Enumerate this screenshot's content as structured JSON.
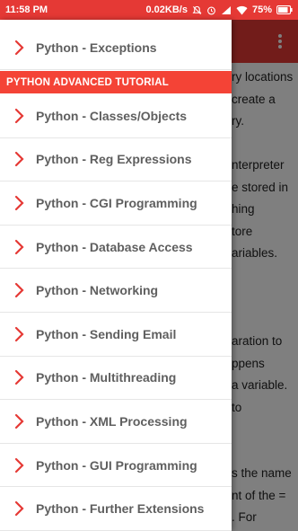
{
  "status_bar": {
    "time": "11:58 PM",
    "network_speed": "0.02KB/s",
    "battery": "75%",
    "icons": [
      "mute-icon",
      "alarm-icon",
      "signal-icon",
      "wifi-icon",
      "battery-icon"
    ]
  },
  "colors": {
    "accent": "#e53935",
    "section_header": "#f44336",
    "chevron": "#e53935",
    "item_text": "#5f5f5f"
  },
  "drawer": {
    "top_item": {
      "label": "Python - Exceptions"
    },
    "section_title": "PYTHON ADVANCED TUTORIAL",
    "items": [
      {
        "label": "Python - Classes/Objects"
      },
      {
        "label": "Python - Reg Expressions"
      },
      {
        "label": "Python - CGI Programming"
      },
      {
        "label": "Python - Database Access"
      },
      {
        "label": "Python - Networking"
      },
      {
        "label": "Python - Sending Email"
      },
      {
        "label": "Python - Multithreading"
      },
      {
        "label": "Python - XML Processing"
      },
      {
        "label": "Python - GUI Programming"
      },
      {
        "label": "Python - Further Extensions"
      }
    ]
  },
  "background_content": {
    "lines": [
      "ry locations",
      "create a",
      "ry.",
      "",
      "nterpreter",
      "e stored in",
      "hing",
      "tore",
      "ariables.",
      "",
      "",
      "",
      "aration to",
      "ppens",
      "a variable.",
      "to",
      "",
      "",
      "s the name",
      "nt of the =",
      ". For"
    ]
  }
}
